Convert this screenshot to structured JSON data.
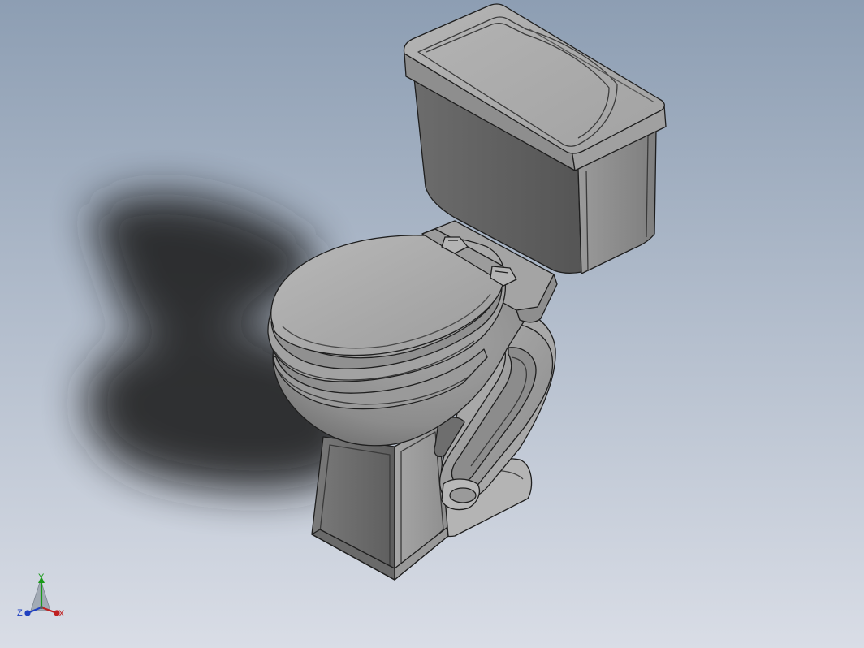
{
  "viewport": {
    "background_top": "#8d9eb3",
    "background_bottom": "#d9dde6",
    "model_color": "#8a8a8a",
    "edge_color": "#1e1e1e",
    "shadow_color": "#1c1c1c"
  },
  "triad": {
    "y_label": "Y",
    "x_label": "X",
    "z_label": "Z",
    "y_color": "#1a9a1a",
    "x_color": "#c02020",
    "z_color": "#2040c0"
  }
}
